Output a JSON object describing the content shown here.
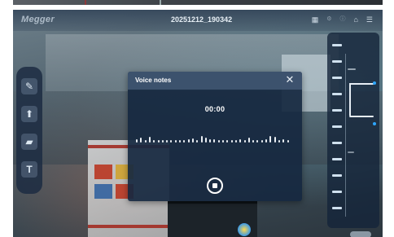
{
  "app": {
    "logo": "Megger",
    "recording_name": "20251212_190342",
    "top_icons": [
      "grid-icon",
      "settings-icon",
      "info-icon",
      "home-icon",
      "menu-icon"
    ]
  },
  "toolbar": {
    "tools": [
      "pencil-icon",
      "arrow-up-icon",
      "camera-icon",
      "text-icon"
    ]
  },
  "voice_notes": {
    "title": "Voice notes",
    "close_icon": "✕",
    "timer": "00:00",
    "stop_icon": "stop-icon"
  },
  "colors": {
    "modal_bg": "#162840",
    "modal_header": "#425874",
    "toolbar_bg": "#1c2c42",
    "accent": "#2ea6ff"
  }
}
